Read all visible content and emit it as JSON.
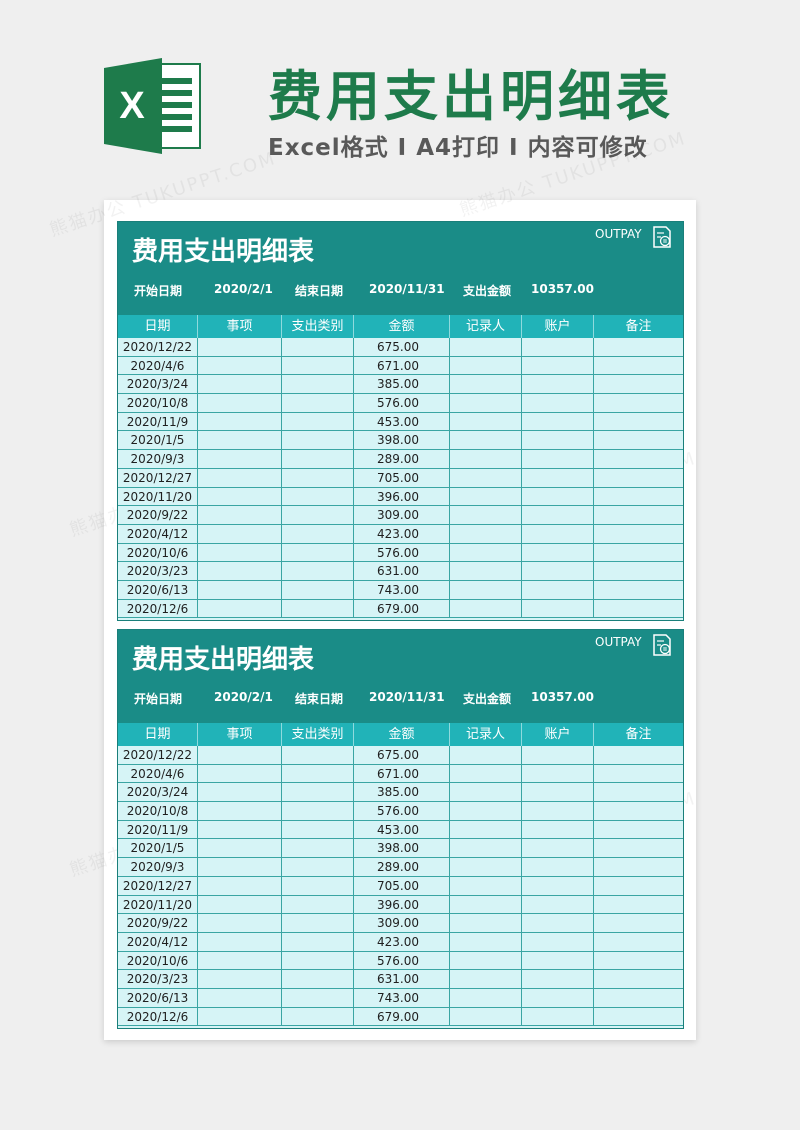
{
  "banner": {
    "logo_letter": "X",
    "title": "费用支出明细表",
    "subtitle": "Excel格式 Ι A4打印 Ι 内容可修改"
  },
  "watermark": "熊猫办公 TUKUPPT.COM",
  "sheets": [
    {
      "title": "费用支出明细表",
      "badge": "OUTPAY",
      "meta": {
        "start_label": "开始日期",
        "start_value": "2020/2/1",
        "end_label": "结束日期",
        "end_value": "2020/11/31",
        "total_label": "支出金额",
        "total_value": "10357.00"
      },
      "columns": [
        "日期",
        "事项",
        "支出类别",
        "金额",
        "记录人",
        "账户",
        "备注"
      ],
      "rows": [
        [
          "2020/12/22",
          "",
          "",
          "675.00",
          "",
          "",
          ""
        ],
        [
          "2020/4/6",
          "",
          "",
          "671.00",
          "",
          "",
          ""
        ],
        [
          "2020/3/24",
          "",
          "",
          "385.00",
          "",
          "",
          ""
        ],
        [
          "2020/10/8",
          "",
          "",
          "576.00",
          "",
          "",
          ""
        ],
        [
          "2020/11/9",
          "",
          "",
          "453.00",
          "",
          "",
          ""
        ],
        [
          "2020/1/5",
          "",
          "",
          "398.00",
          "",
          "",
          ""
        ],
        [
          "2020/9/3",
          "",
          "",
          "289.00",
          "",
          "",
          ""
        ],
        [
          "2020/12/27",
          "",
          "",
          "705.00",
          "",
          "",
          ""
        ],
        [
          "2020/11/20",
          "",
          "",
          "396.00",
          "",
          "",
          ""
        ],
        [
          "2020/9/22",
          "",
          "",
          "309.00",
          "",
          "",
          ""
        ],
        [
          "2020/4/12",
          "",
          "",
          "423.00",
          "",
          "",
          ""
        ],
        [
          "2020/10/6",
          "",
          "",
          "576.00",
          "",
          "",
          ""
        ],
        [
          "2020/3/23",
          "",
          "",
          "631.00",
          "",
          "",
          ""
        ],
        [
          "2020/6/13",
          "",
          "",
          "743.00",
          "",
          "",
          ""
        ],
        [
          "2020/12/6",
          "",
          "",
          "679.00",
          "",
          "",
          ""
        ]
      ]
    },
    {
      "title": "费用支出明细表",
      "badge": "OUTPAY",
      "meta": {
        "start_label": "开始日期",
        "start_value": "2020/2/1",
        "end_label": "结束日期",
        "end_value": "2020/11/31",
        "total_label": "支出金额",
        "total_value": "10357.00"
      },
      "columns": [
        "日期",
        "事项",
        "支出类别",
        "金额",
        "记录人",
        "账户",
        "备注"
      ],
      "rows": [
        [
          "2020/12/22",
          "",
          "",
          "675.00",
          "",
          "",
          ""
        ],
        [
          "2020/4/6",
          "",
          "",
          "671.00",
          "",
          "",
          ""
        ],
        [
          "2020/3/24",
          "",
          "",
          "385.00",
          "",
          "",
          ""
        ],
        [
          "2020/10/8",
          "",
          "",
          "576.00",
          "",
          "",
          ""
        ],
        [
          "2020/11/9",
          "",
          "",
          "453.00",
          "",
          "",
          ""
        ],
        [
          "2020/1/5",
          "",
          "",
          "398.00",
          "",
          "",
          ""
        ],
        [
          "2020/9/3",
          "",
          "",
          "289.00",
          "",
          "",
          ""
        ],
        [
          "2020/12/27",
          "",
          "",
          "705.00",
          "",
          "",
          ""
        ],
        [
          "2020/11/20",
          "",
          "",
          "396.00",
          "",
          "",
          ""
        ],
        [
          "2020/9/22",
          "",
          "",
          "309.00",
          "",
          "",
          ""
        ],
        [
          "2020/4/12",
          "",
          "",
          "423.00",
          "",
          "",
          ""
        ],
        [
          "2020/10/6",
          "",
          "",
          "576.00",
          "",
          "",
          ""
        ],
        [
          "2020/3/23",
          "",
          "",
          "631.00",
          "",
          "",
          ""
        ],
        [
          "2020/6/13",
          "",
          "",
          "743.00",
          "",
          "",
          ""
        ],
        [
          "2020/12/6",
          "",
          "",
          "679.00",
          "",
          "",
          ""
        ]
      ]
    }
  ],
  "colors": {
    "brand_green": "#1e7b4b",
    "sheet_header": "#1a8c87",
    "column_header": "#21b3b8",
    "row_fill": "#d6f4f6"
  },
  "icons": {
    "logo": "excel-logo-icon",
    "badge": "receipt-icon"
  }
}
